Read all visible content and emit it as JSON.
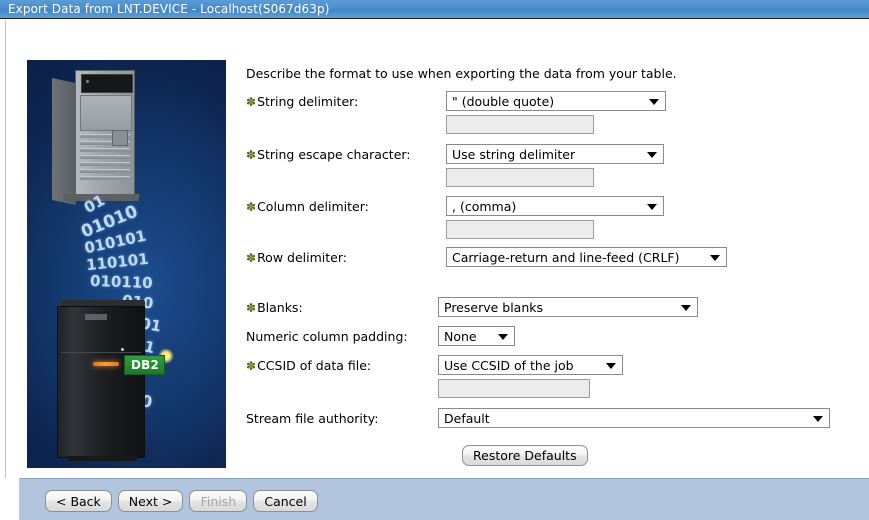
{
  "window": {
    "title": "Export Data from LNT.DEVICE - Localhost(S067d63p)",
    "accent_color": "#4a8ecb",
    "panel_header_color": "#b3c5de"
  },
  "page": {
    "intro": "Describe the format to use when exporting the data from your table.",
    "required_marker": "✽"
  },
  "fields": {
    "string_delimiter": {
      "label": "String delimiter:",
      "required": true,
      "value": "\" (double quote)",
      "custom_value": "",
      "custom_enabled": false
    },
    "string_escape_character": {
      "label": "String escape character:",
      "required": true,
      "value": "Use string delimiter",
      "custom_value": "",
      "custom_enabled": false
    },
    "column_delimiter": {
      "label": "Column delimiter:",
      "required": true,
      "value": ", (comma)",
      "custom_value": "",
      "custom_enabled": false
    },
    "row_delimiter": {
      "label": "Row delimiter:",
      "required": true,
      "value": "Carriage-return and line-feed (CRLF)"
    },
    "blanks": {
      "label": "Blanks:",
      "required": true,
      "value": "Preserve blanks"
    },
    "numeric_column_padding": {
      "label": "Numeric column padding:",
      "required": false,
      "value": "None"
    },
    "ccsid_of_data_file": {
      "label": "CCSID of data file:",
      "required": true,
      "value": "Use CCSID of the job",
      "custom_value": "",
      "custom_enabled": false
    },
    "stream_file_authority": {
      "label": "Stream file authority:",
      "required": false,
      "value": "Default"
    }
  },
  "buttons": {
    "restore_defaults": "Restore Defaults",
    "back": "< Back",
    "next": "Next >",
    "finish": "Finish",
    "cancel": "Cancel"
  },
  "banner": {
    "badge": "DB2",
    "binary_lines": [
      "01",
      "01010",
      "010101",
      "110101",
      "010110",
      "010",
      "001",
      "01",
      "1",
      "10",
      "1"
    ]
  }
}
